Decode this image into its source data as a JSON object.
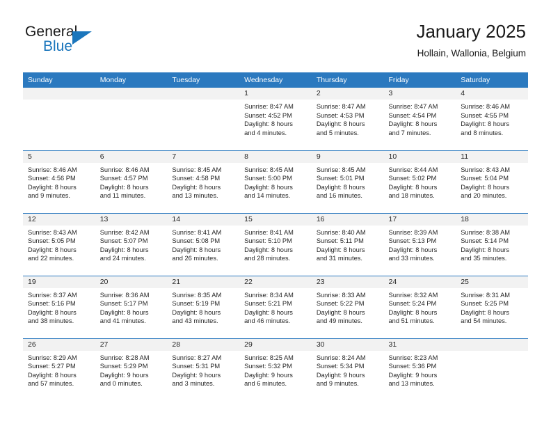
{
  "brand": {
    "name_top": "General",
    "name_bottom": "Blue",
    "color_primary": "#1b76bc",
    "logo_icon": "triangle-logo-icon"
  },
  "header": {
    "title": "January 2025",
    "subtitle": "Hollain, Wallonia, Belgium"
  },
  "theme": {
    "header_bg": "#2b79bf",
    "daynum_bg": "#f2f2f2",
    "text": "#262626"
  },
  "weekday_headers": [
    "Sunday",
    "Monday",
    "Tuesday",
    "Wednesday",
    "Thursday",
    "Friday",
    "Saturday"
  ],
  "labels": {
    "sunrise_prefix": "Sunrise:",
    "sunset_prefix": "Sunset:",
    "daylight_prefix": "Daylight:"
  },
  "weeks": [
    [
      {
        "day": "",
        "empty": true,
        "line1": "",
        "line2": "",
        "line3": "",
        "line4": ""
      },
      {
        "day": "",
        "empty": true,
        "line1": "",
        "line2": "",
        "line3": "",
        "line4": ""
      },
      {
        "day": "",
        "empty": true,
        "line1": "",
        "line2": "",
        "line3": "",
        "line4": ""
      },
      {
        "day": "1",
        "empty": false,
        "line1": "Sunrise: 8:47 AM",
        "line2": "Sunset: 4:52 PM",
        "line3": "Daylight: 8 hours",
        "line4": "and 4 minutes."
      },
      {
        "day": "2",
        "empty": false,
        "line1": "Sunrise: 8:47 AM",
        "line2": "Sunset: 4:53 PM",
        "line3": "Daylight: 8 hours",
        "line4": "and 5 minutes."
      },
      {
        "day": "3",
        "empty": false,
        "line1": "Sunrise: 8:47 AM",
        "line2": "Sunset: 4:54 PM",
        "line3": "Daylight: 8 hours",
        "line4": "and 7 minutes."
      },
      {
        "day": "4",
        "empty": false,
        "line1": "Sunrise: 8:46 AM",
        "line2": "Sunset: 4:55 PM",
        "line3": "Daylight: 8 hours",
        "line4": "and 8 minutes."
      }
    ],
    [
      {
        "day": "5",
        "empty": false,
        "line1": "Sunrise: 8:46 AM",
        "line2": "Sunset: 4:56 PM",
        "line3": "Daylight: 8 hours",
        "line4": "and 9 minutes."
      },
      {
        "day": "6",
        "empty": false,
        "line1": "Sunrise: 8:46 AM",
        "line2": "Sunset: 4:57 PM",
        "line3": "Daylight: 8 hours",
        "line4": "and 11 minutes."
      },
      {
        "day": "7",
        "empty": false,
        "line1": "Sunrise: 8:45 AM",
        "line2": "Sunset: 4:58 PM",
        "line3": "Daylight: 8 hours",
        "line4": "and 13 minutes."
      },
      {
        "day": "8",
        "empty": false,
        "line1": "Sunrise: 8:45 AM",
        "line2": "Sunset: 5:00 PM",
        "line3": "Daylight: 8 hours",
        "line4": "and 14 minutes."
      },
      {
        "day": "9",
        "empty": false,
        "line1": "Sunrise: 8:45 AM",
        "line2": "Sunset: 5:01 PM",
        "line3": "Daylight: 8 hours",
        "line4": "and 16 minutes."
      },
      {
        "day": "10",
        "empty": false,
        "line1": "Sunrise: 8:44 AM",
        "line2": "Sunset: 5:02 PM",
        "line3": "Daylight: 8 hours",
        "line4": "and 18 minutes."
      },
      {
        "day": "11",
        "empty": false,
        "line1": "Sunrise: 8:43 AM",
        "line2": "Sunset: 5:04 PM",
        "line3": "Daylight: 8 hours",
        "line4": "and 20 minutes."
      }
    ],
    [
      {
        "day": "12",
        "empty": false,
        "line1": "Sunrise: 8:43 AM",
        "line2": "Sunset: 5:05 PM",
        "line3": "Daylight: 8 hours",
        "line4": "and 22 minutes."
      },
      {
        "day": "13",
        "empty": false,
        "line1": "Sunrise: 8:42 AM",
        "line2": "Sunset: 5:07 PM",
        "line3": "Daylight: 8 hours",
        "line4": "and 24 minutes."
      },
      {
        "day": "14",
        "empty": false,
        "line1": "Sunrise: 8:41 AM",
        "line2": "Sunset: 5:08 PM",
        "line3": "Daylight: 8 hours",
        "line4": "and 26 minutes."
      },
      {
        "day": "15",
        "empty": false,
        "line1": "Sunrise: 8:41 AM",
        "line2": "Sunset: 5:10 PM",
        "line3": "Daylight: 8 hours",
        "line4": "and 28 minutes."
      },
      {
        "day": "16",
        "empty": false,
        "line1": "Sunrise: 8:40 AM",
        "line2": "Sunset: 5:11 PM",
        "line3": "Daylight: 8 hours",
        "line4": "and 31 minutes."
      },
      {
        "day": "17",
        "empty": false,
        "line1": "Sunrise: 8:39 AM",
        "line2": "Sunset: 5:13 PM",
        "line3": "Daylight: 8 hours",
        "line4": "and 33 minutes."
      },
      {
        "day": "18",
        "empty": false,
        "line1": "Sunrise: 8:38 AM",
        "line2": "Sunset: 5:14 PM",
        "line3": "Daylight: 8 hours",
        "line4": "and 35 minutes."
      }
    ],
    [
      {
        "day": "19",
        "empty": false,
        "line1": "Sunrise: 8:37 AM",
        "line2": "Sunset: 5:16 PM",
        "line3": "Daylight: 8 hours",
        "line4": "and 38 minutes."
      },
      {
        "day": "20",
        "empty": false,
        "line1": "Sunrise: 8:36 AM",
        "line2": "Sunset: 5:17 PM",
        "line3": "Daylight: 8 hours",
        "line4": "and 41 minutes."
      },
      {
        "day": "21",
        "empty": false,
        "line1": "Sunrise: 8:35 AM",
        "line2": "Sunset: 5:19 PM",
        "line3": "Daylight: 8 hours",
        "line4": "and 43 minutes."
      },
      {
        "day": "22",
        "empty": false,
        "line1": "Sunrise: 8:34 AM",
        "line2": "Sunset: 5:21 PM",
        "line3": "Daylight: 8 hours",
        "line4": "and 46 minutes."
      },
      {
        "day": "23",
        "empty": false,
        "line1": "Sunrise: 8:33 AM",
        "line2": "Sunset: 5:22 PM",
        "line3": "Daylight: 8 hours",
        "line4": "and 49 minutes."
      },
      {
        "day": "24",
        "empty": false,
        "line1": "Sunrise: 8:32 AM",
        "line2": "Sunset: 5:24 PM",
        "line3": "Daylight: 8 hours",
        "line4": "and 51 minutes."
      },
      {
        "day": "25",
        "empty": false,
        "line1": "Sunrise: 8:31 AM",
        "line2": "Sunset: 5:25 PM",
        "line3": "Daylight: 8 hours",
        "line4": "and 54 minutes."
      }
    ],
    [
      {
        "day": "26",
        "empty": false,
        "line1": "Sunrise: 8:29 AM",
        "line2": "Sunset: 5:27 PM",
        "line3": "Daylight: 8 hours",
        "line4": "and 57 minutes."
      },
      {
        "day": "27",
        "empty": false,
        "line1": "Sunrise: 8:28 AM",
        "line2": "Sunset: 5:29 PM",
        "line3": "Daylight: 9 hours",
        "line4": "and 0 minutes."
      },
      {
        "day": "28",
        "empty": false,
        "line1": "Sunrise: 8:27 AM",
        "line2": "Sunset: 5:31 PM",
        "line3": "Daylight: 9 hours",
        "line4": "and 3 minutes."
      },
      {
        "day": "29",
        "empty": false,
        "line1": "Sunrise: 8:25 AM",
        "line2": "Sunset: 5:32 PM",
        "line3": "Daylight: 9 hours",
        "line4": "and 6 minutes."
      },
      {
        "day": "30",
        "empty": false,
        "line1": "Sunrise: 8:24 AM",
        "line2": "Sunset: 5:34 PM",
        "line3": "Daylight: 9 hours",
        "line4": "and 9 minutes."
      },
      {
        "day": "31",
        "empty": false,
        "line1": "Sunrise: 8:23 AM",
        "line2": "Sunset: 5:36 PM",
        "line3": "Daylight: 9 hours",
        "line4": "and 13 minutes."
      },
      {
        "day": "",
        "empty": true,
        "line1": "",
        "line2": "",
        "line3": "",
        "line4": ""
      }
    ]
  ]
}
